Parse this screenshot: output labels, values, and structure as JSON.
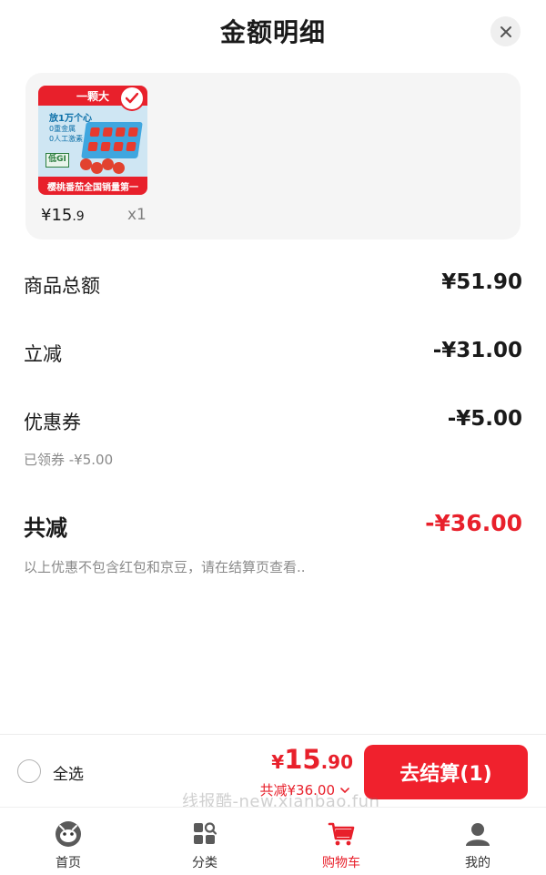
{
  "header": {
    "title": "金额明细",
    "close_icon": "close-icon"
  },
  "product": {
    "image": {
      "top_text": "一颗大",
      "line1": "放1万个心",
      "line2": "0重金属",
      "line3": "0人工激素",
      "gi_label": "低GI",
      "bottom_text": "樱桃番茄全国销量第一"
    },
    "price_currency": "¥",
    "price_int": "15",
    "price_dec": ".9",
    "quantity": "x1"
  },
  "breakdown": {
    "subtotal_label": "商品总额",
    "subtotal_value": "¥51.90",
    "instant_discount_label": "立减",
    "instant_discount_value": "-¥31.00",
    "coupon_label": "优惠券",
    "coupon_value": "-¥5.00",
    "coupon_note": "已领券 -¥5.00",
    "total_reduction_label": "共减",
    "total_reduction_value": "-¥36.00",
    "disclaimer": "以上优惠不包含红包和京豆，请在结算页查看.."
  },
  "checkout_bar": {
    "select_all_label": "全选",
    "price_currency": "¥",
    "price_int": "15",
    "price_dec": ".90",
    "discount_text": "共减¥36.00",
    "checkout_label": "去结算(1)"
  },
  "watermark": "线报酷-new.xianbao.fun",
  "tabbar": {
    "items": [
      {
        "label": "首页",
        "icon": "home-mascot-icon"
      },
      {
        "label": "分类",
        "icon": "category-grid-icon"
      },
      {
        "label": "购物车",
        "icon": "cart-icon",
        "active": true
      },
      {
        "label": "我的",
        "icon": "user-icon"
      }
    ]
  },
  "colors": {
    "accent": "#e8202b",
    "text": "#1a1a1a",
    "muted": "#8a8a8a"
  }
}
